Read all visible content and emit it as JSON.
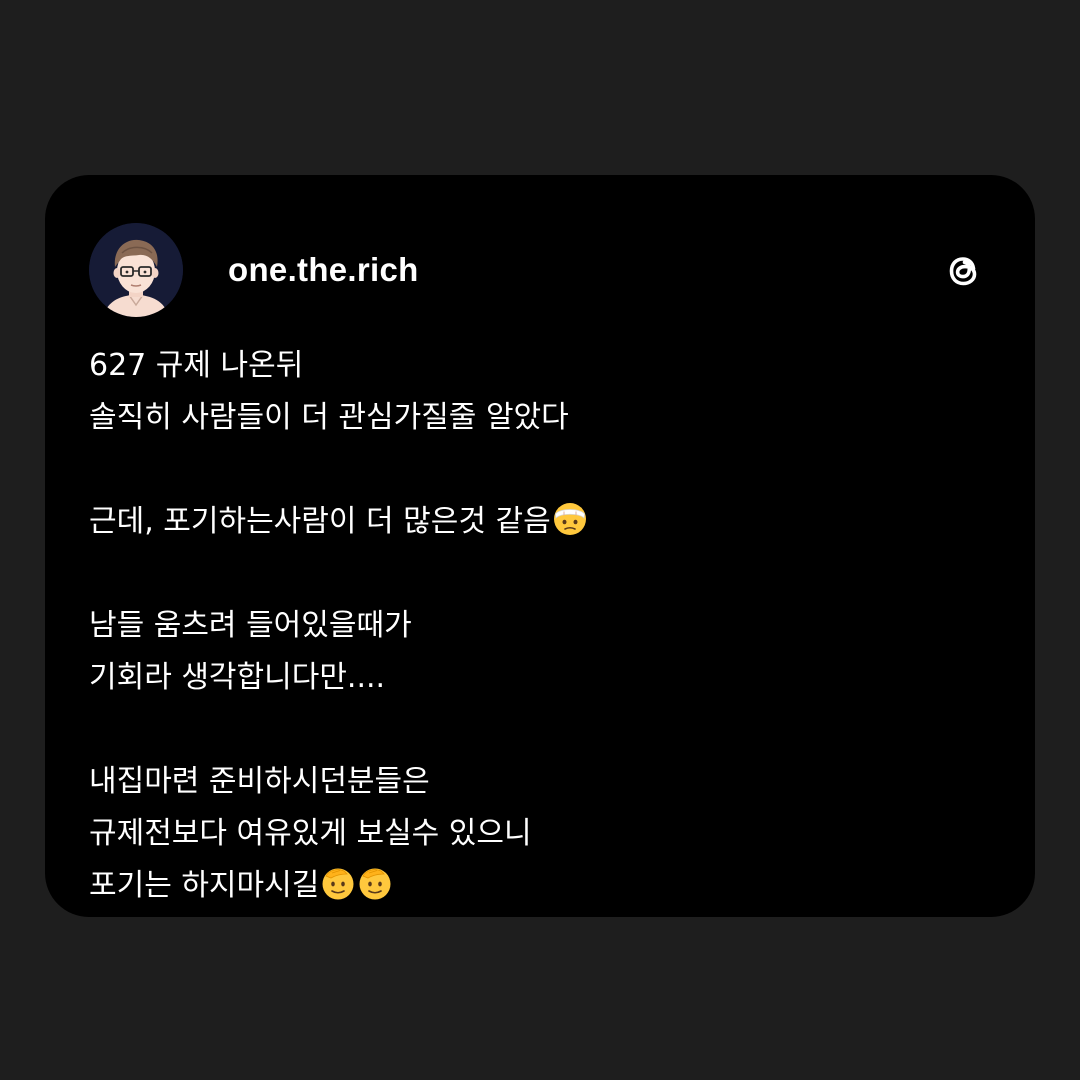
{
  "post": {
    "author": {
      "username": "one.the.rich",
      "avatar_icon": "cartoon-man-with-glasses-avatar"
    },
    "platform_icon": "threads-logo-icon",
    "lines": [
      "627 규제 나온뒤",
      "솔직히 사람들이 더 관심가질줄 알았다",
      "",
      "근데, 포기하는사람이 더 많은것 같음",
      "",
      "남들 움츠려 들어있을때가",
      "기회라 생각합니다만....",
      "",
      "내집마련 준비하시던분들은",
      "규제전보다 여유있게 보실수 있으니",
      "포기는 하지마시길"
    ],
    "emojis": {
      "line4": "face-with-head-bandage-emoji",
      "line11": "saluting-face-emoji"
    }
  },
  "colors": {
    "page_background": "#1e1e1e",
    "card_background": "#000000",
    "text": "#ffffff"
  }
}
